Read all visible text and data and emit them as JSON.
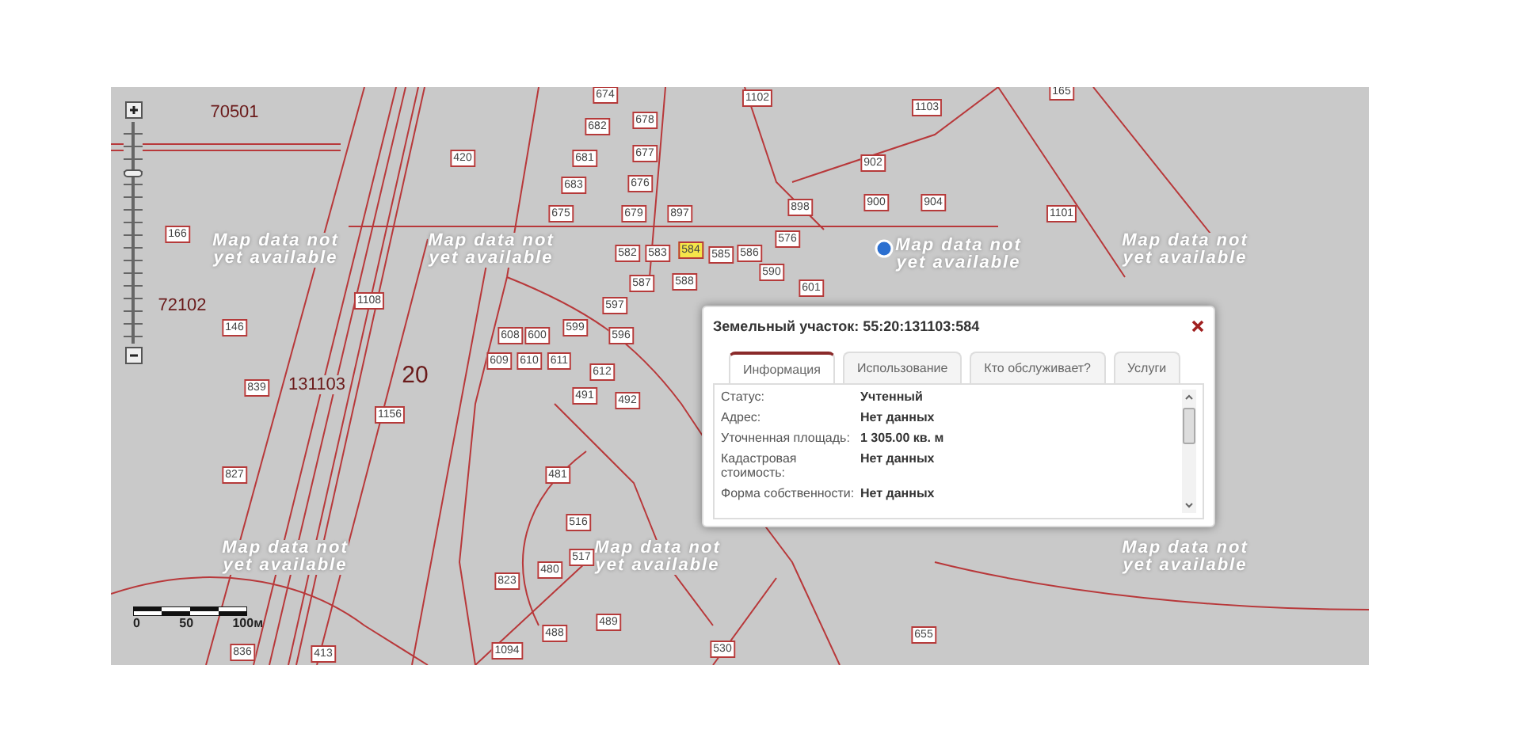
{
  "map": {
    "zones": [
      "70501",
      "72102",
      "20",
      "131103"
    ],
    "notices": [
      "Map data not\nyet available",
      "Map data not\nyet available",
      "Map data not\nyet available",
      "Map data not\nyet available",
      "Map data not\nyet available",
      "Map data not\nyet available",
      "Map data not\nyet available"
    ],
    "parcels": [
      {
        "label": "674",
        "selected": false
      },
      {
        "label": "1102",
        "selected": false
      },
      {
        "label": "1103",
        "selected": false
      },
      {
        "label": "682",
        "selected": false
      },
      {
        "label": "678",
        "selected": false
      },
      {
        "label": "681",
        "selected": false
      },
      {
        "label": "677",
        "selected": false
      },
      {
        "label": "683",
        "selected": false
      },
      {
        "label": "676",
        "selected": false
      },
      {
        "label": "902",
        "selected": false
      },
      {
        "label": "675",
        "selected": false
      },
      {
        "label": "679",
        "selected": false
      },
      {
        "label": "897",
        "selected": false
      },
      {
        "label": "900",
        "selected": false
      },
      {
        "label": "904",
        "selected": false
      },
      {
        "label": "898",
        "selected": false
      },
      {
        "label": "582",
        "selected": false
      },
      {
        "label": "583",
        "selected": false
      },
      {
        "label": "584",
        "selected": true
      },
      {
        "label": "585",
        "selected": false
      },
      {
        "label": "586",
        "selected": false
      },
      {
        "label": "576",
        "selected": false
      },
      {
        "label": "587",
        "selected": false
      },
      {
        "label": "588",
        "selected": false
      },
      {
        "label": "590",
        "selected": false
      },
      {
        "label": "601",
        "selected": false
      },
      {
        "label": "420",
        "selected": false
      },
      {
        "label": "166",
        "selected": false
      },
      {
        "label": "1108",
        "selected": false
      },
      {
        "label": "146",
        "selected": false
      },
      {
        "label": "1156",
        "selected": false
      },
      {
        "label": "839",
        "selected": false
      },
      {
        "label": "827",
        "selected": false
      },
      {
        "label": "823",
        "selected": false
      },
      {
        "label": "836",
        "selected": false
      },
      {
        "label": "413",
        "selected": false
      },
      {
        "label": "1094",
        "selected": false
      },
      {
        "label": "530",
        "selected": false
      },
      {
        "label": "655",
        "selected": false
      },
      {
        "label": "1101",
        "selected": false
      },
      {
        "label": "165",
        "selected": false
      },
      {
        "label": "488",
        "selected": false
      },
      {
        "label": "489",
        "selected": false
      },
      {
        "label": "516",
        "selected": false
      },
      {
        "label": "517",
        "selected": false
      },
      {
        "label": "480",
        "selected": false
      },
      {
        "label": "481",
        "selected": false
      },
      {
        "label": "491",
        "selected": false
      },
      {
        "label": "492",
        "selected": false
      },
      {
        "label": "610",
        "selected": false
      },
      {
        "label": "611",
        "selected": false
      },
      {
        "label": "612",
        "selected": false
      },
      {
        "label": "608",
        "selected": false
      },
      {
        "label": "609",
        "selected": false
      },
      {
        "label": "600",
        "selected": false
      },
      {
        "label": "599",
        "selected": false
      },
      {
        "label": "596",
        "selected": false
      },
      {
        "label": "597",
        "selected": false
      }
    ],
    "zoom": {
      "level": 0.78
    },
    "scale": [
      "0",
      "50",
      "100м"
    ]
  },
  "popup": {
    "title": "Земельный участок: 55:20:131103:584",
    "tabs": [
      {
        "label": "Информация",
        "selected": true
      },
      {
        "label": "Использование",
        "selected": false
      },
      {
        "label": "Кто обслуживает?",
        "selected": false
      },
      {
        "label": "Услуги",
        "selected": false
      }
    ],
    "rows": [
      {
        "label": "Статус:",
        "value": "Учтенный"
      },
      {
        "label": "Адрес:",
        "value": "Нет данных"
      },
      {
        "label": "Уточненная площадь:",
        "value": "1 305.00 кв. м"
      },
      {
        "label": "Кадастровая стоимость:",
        "value": "Нет данных"
      },
      {
        "label": "Форма собственности:",
        "value": "Нет данных"
      }
    ]
  }
}
